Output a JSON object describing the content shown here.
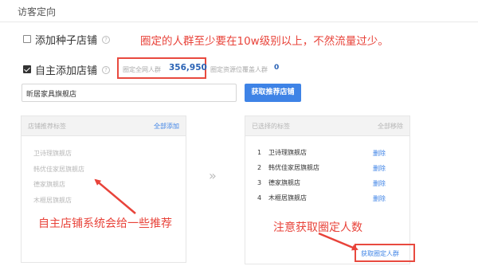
{
  "header": {
    "title": "访客定向"
  },
  "options": {
    "seed": {
      "label": "添加种子店铺",
      "checked": false,
      "help_icon": "question-circle-icon"
    },
    "manual": {
      "label": "自主添加店铺",
      "checked": true,
      "help_icon": "question-circle-icon"
    }
  },
  "stats": {
    "network_label": "圈定全网人群",
    "network_value": "356,950",
    "coverage_label": "圈定资源位覆盖人群",
    "coverage_value": "0"
  },
  "search": {
    "value": "昕居家具旗舰店",
    "button": "获取推荐店铺"
  },
  "left_panel": {
    "title": "店铺推荐标签",
    "action": "全部添加",
    "items": [
      "卫诗理旗舰店",
      "韩优佳家居旗舰店",
      "德家旗舰店",
      "木榧居旗舰店"
    ]
  },
  "transfer_icon": "»",
  "right_panel": {
    "title": "已选择的标签",
    "action": "全部移除",
    "items": [
      {
        "num": "1",
        "name": "卫诗理旗舰店",
        "action": "删除"
      },
      {
        "num": "2",
        "name": "韩优佳家居旗舰店",
        "action": "删除"
      },
      {
        "num": "3",
        "name": "德家旗舰店",
        "action": "删除"
      },
      {
        "num": "4",
        "name": "木榧居旗舰店",
        "action": "删除"
      }
    ],
    "footer_link": "获取圈定人群"
  },
  "annotations": {
    "top_note": "圈定的人群至少要在10w级别以上，不然流量过少。",
    "left_note": "自主店铺系统会给一些推荐",
    "right_note": "注意获取圈定人数"
  },
  "colors": {
    "accent": "#3e83e6",
    "annotation": "#e8433a",
    "stat_value": "#2b63b5"
  }
}
